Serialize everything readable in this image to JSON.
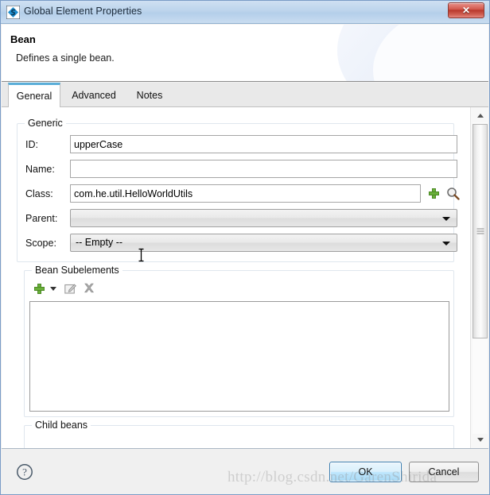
{
  "window": {
    "title": "Global Element Properties",
    "icon": "spring-bean-icon",
    "close_label": "✕"
  },
  "header": {
    "title": "Bean",
    "subtitle": "Defines a single bean."
  },
  "tabs": [
    {
      "label": "General",
      "active": true
    },
    {
      "label": "Advanced",
      "active": false
    },
    {
      "label": "Notes",
      "active": false
    }
  ],
  "generic_group": {
    "legend": "Generic",
    "fields": {
      "id": {
        "label": "ID:",
        "value": "upperCase",
        "placeholder": ""
      },
      "name": {
        "label": "Name:",
        "value": "",
        "placeholder": ""
      },
      "class": {
        "label": "Class:",
        "value": "com.he.util.HelloWorldUtils",
        "placeholder": ""
      },
      "parent": {
        "label": "Parent:",
        "value": ""
      },
      "scope": {
        "label": "Scope:",
        "value": "-- Empty --"
      }
    },
    "class_actions": {
      "add": "add-icon",
      "browse": "search-icon"
    }
  },
  "subelements_group": {
    "legend": "Bean Subelements",
    "toolbar": {
      "add": "add-icon",
      "add_menu": "chevron-down-icon",
      "edit": "edit-icon",
      "delete": "delete-icon"
    },
    "items": []
  },
  "childbeans_group": {
    "legend": "Child beans",
    "items": []
  },
  "scrollbar": {
    "up": "scroll-up-arrow",
    "down": "scroll-down-arrow"
  },
  "footer": {
    "help": "?",
    "ok_label": "OK",
    "cancel_label": "Cancel"
  },
  "watermark": {
    "text": "http://blog.csdn.net/GarenShirida"
  },
  "colors": {
    "titlebar_start": "#cfe0f2",
    "titlebar_end": "#c9dcf0",
    "close_red": "#b8382c",
    "tab_accent": "#5aaed8",
    "ok_border": "#3c7fb1",
    "plus_green": "#6ab03a",
    "window_border": "#7a9cc6"
  }
}
